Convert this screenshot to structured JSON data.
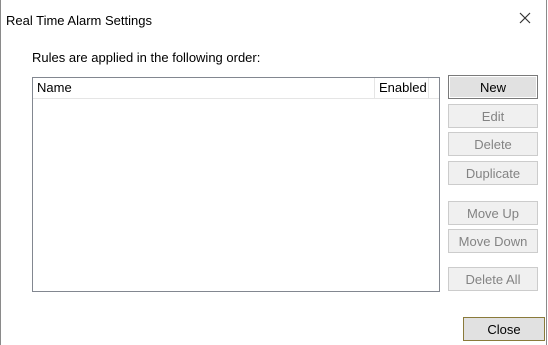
{
  "window": {
    "title": "Real Time Alarm Settings"
  },
  "subtitle": "Rules are applied in the following order:",
  "table": {
    "columns": [
      "Name",
      "Enabled"
    ],
    "rows": []
  },
  "buttons": {
    "new": "New",
    "edit": "Edit",
    "delete": "Delete",
    "duplicate": "Duplicate",
    "move_up": "Move Up",
    "move_down": "Move Down",
    "delete_all": "Delete All",
    "close": "Close"
  },
  "icons": {
    "close_window": "close-icon"
  }
}
